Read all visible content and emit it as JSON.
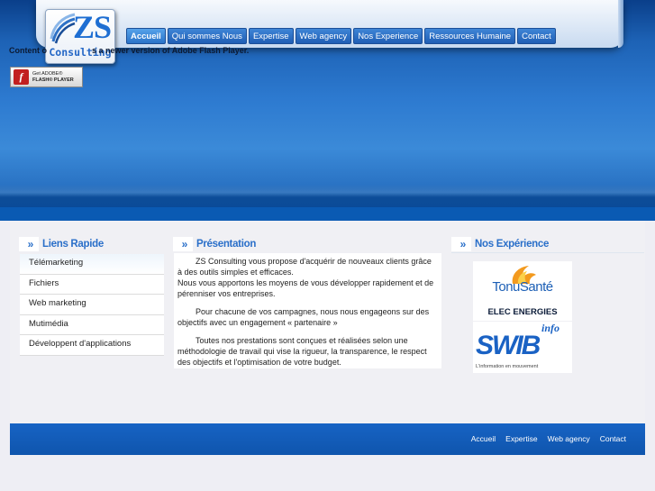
{
  "header": {
    "logo": {
      "main": "ZS",
      "sub": "Consulting"
    },
    "nav": [
      {
        "label": "Accueil",
        "active": true
      },
      {
        "label": "Qui sommes Nous",
        "active": false
      },
      {
        "label": "Expertise",
        "active": false
      },
      {
        "label": "Web agency",
        "active": false
      },
      {
        "label": "Nos Experience",
        "active": false
      },
      {
        "label": "Ressources Humaine",
        "active": false
      },
      {
        "label": "Contact",
        "active": false
      }
    ]
  },
  "flash": {
    "message": "Content o                    s a newer version of Adobe Flash Player.",
    "badge_line1": "Get ADOBE®",
    "badge_line2": "FLASH® PLAYER"
  },
  "liens": {
    "title": "Liens Rapide",
    "items": [
      "Télémarketing",
      "Fichiers",
      "Web marketing",
      "Mutimédia",
      "Développent d'applications"
    ]
  },
  "presentation": {
    "title": "Présentation",
    "p1": "ZS Consulting vous propose d'acquérir de nouveaux clients grâce à des outils simples et efficaces.",
    "p2": "Nous vous apportons les moyens de vous développer rapidement et de pérenniser vos entreprises.",
    "p3": "Pour chacune de vos campagnes, nous nous engageons sur des objectifs avec un engagement « partenaire »",
    "p4": "Toutes nos prestations sont conçues et réalisées selon une méthodologie de travail qui vise la rigueur, la transparence, le respect des objectifs et l'optimisation de votre budget."
  },
  "experience": {
    "title": "Nos Expérience",
    "logo1_name": "TonuSanté",
    "logo1_sub": "ELEC ENERGIES",
    "logo2_info": "info",
    "logo2_name": "SWIB",
    "logo2_tag": "L'information en mouvement"
  },
  "footer": {
    "links": [
      "Accueil",
      "Expertise",
      "Web agency",
      "Contact"
    ]
  },
  "colors": {
    "primary_blue": "#1f5eb5",
    "accent_text": "#2a6fc9",
    "footer_blue": "#1763c4"
  }
}
